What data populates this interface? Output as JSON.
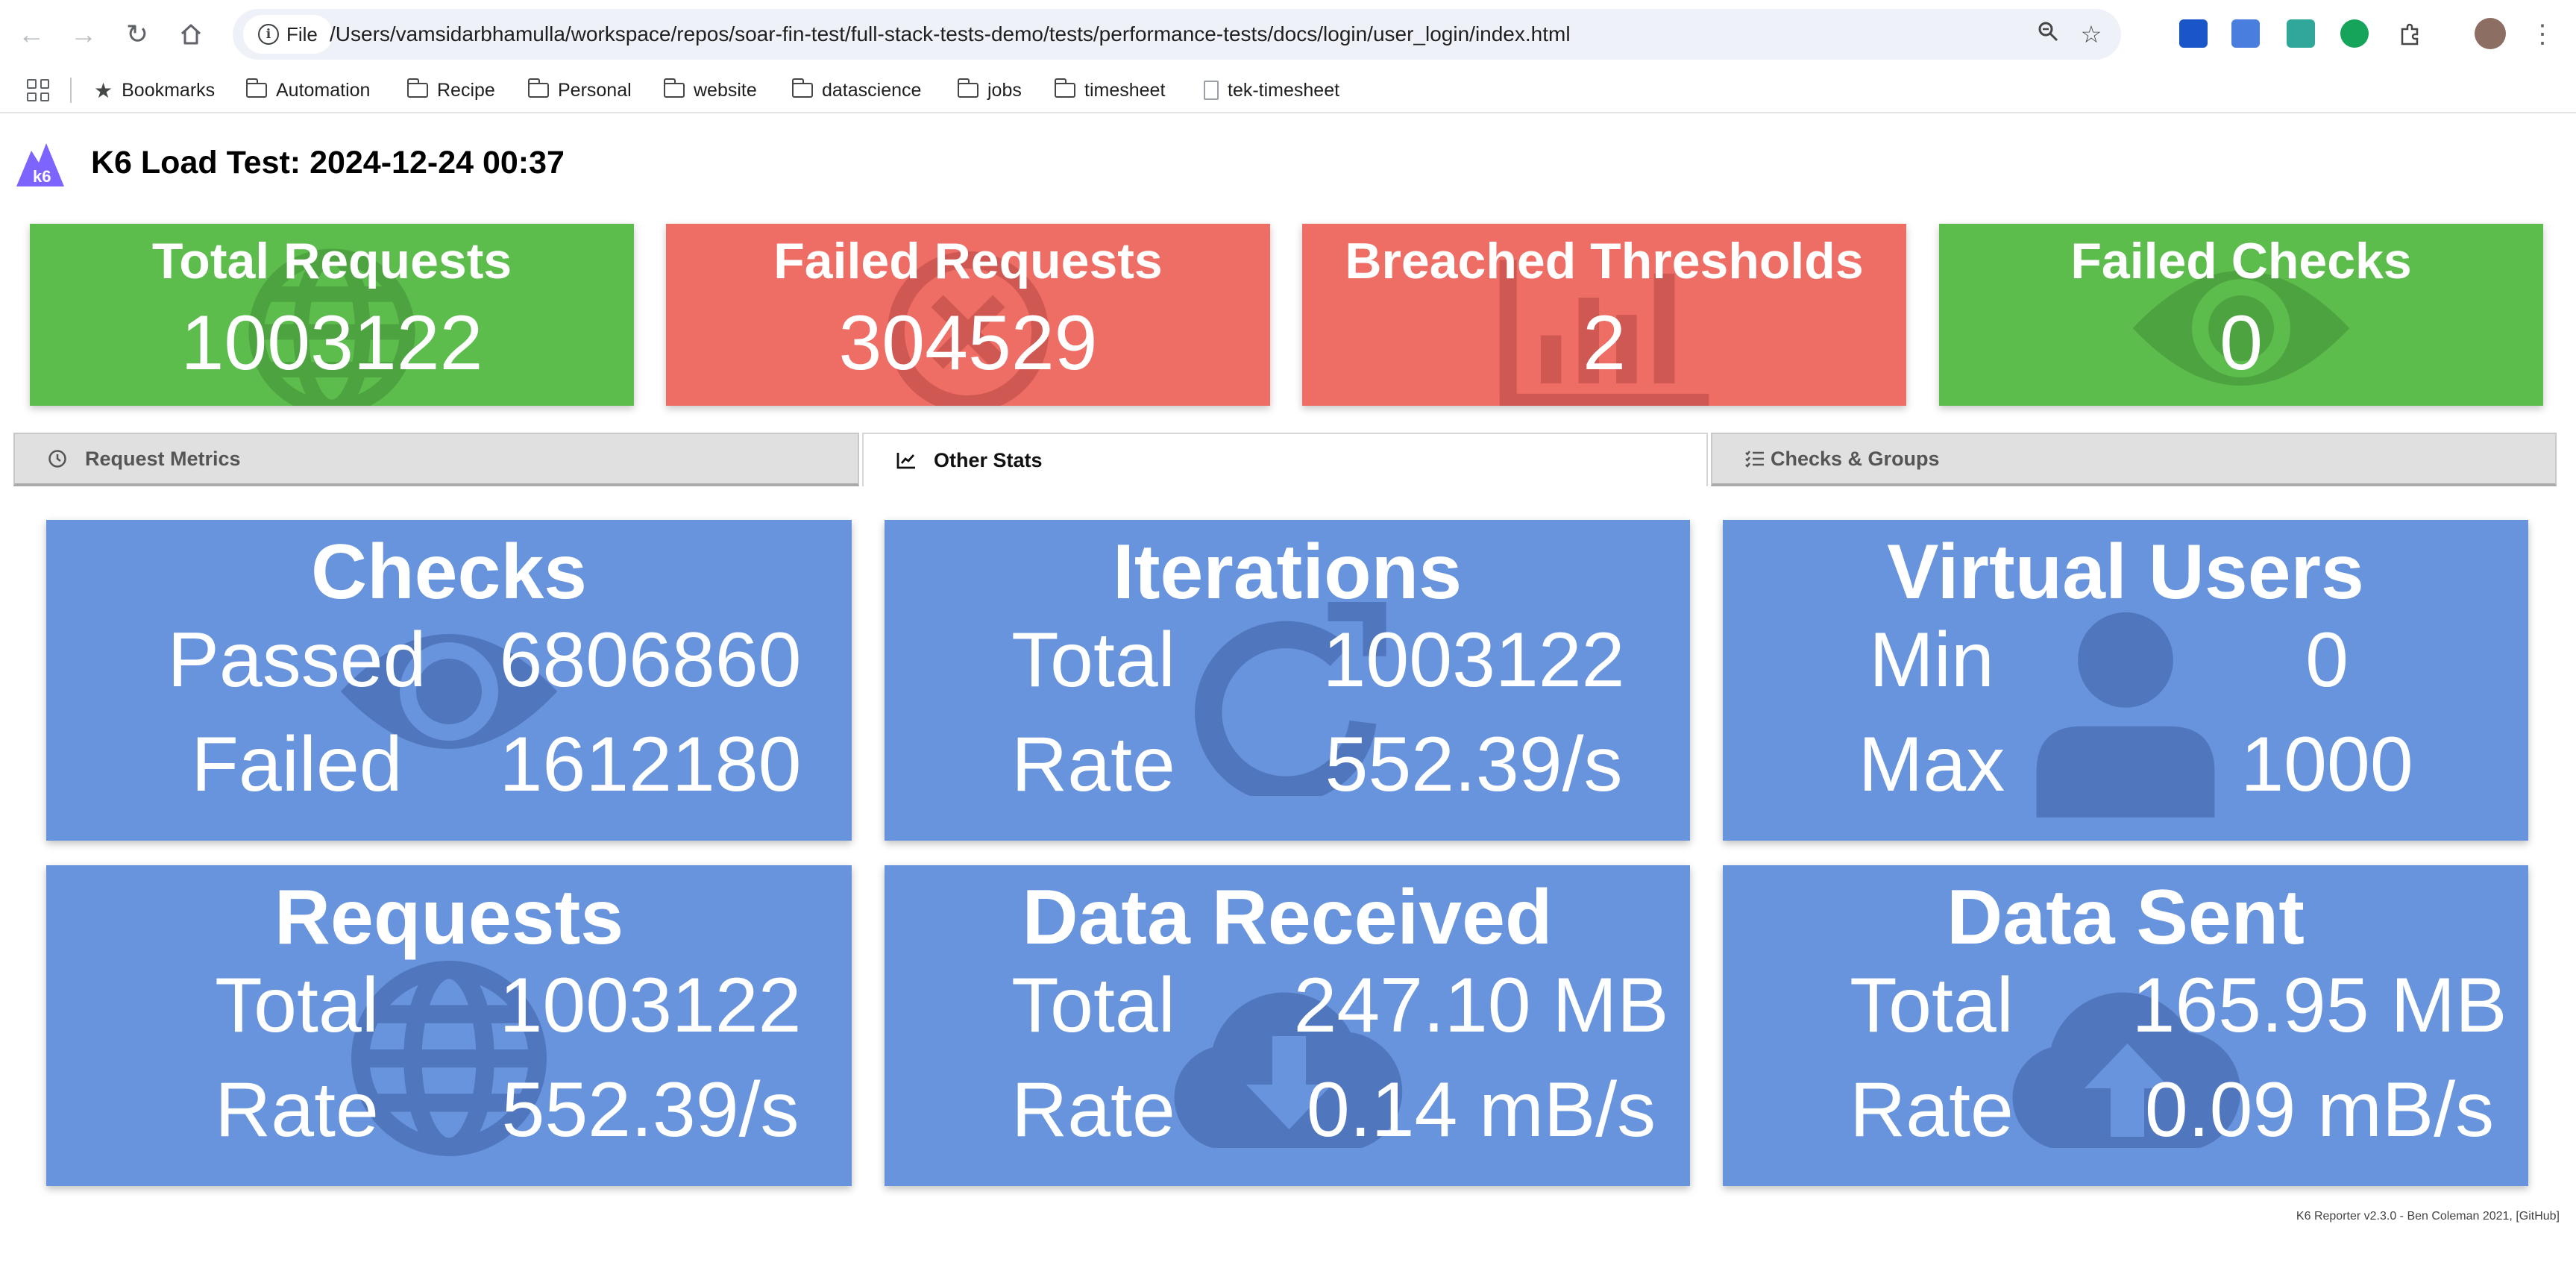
{
  "browser": {
    "file_label": "File",
    "url": "/Users/vamsidarbhamulla/workspace/repos/soar-fin-test/full-stack-tests-demo/tests/performance-tests/docs/login/user_login/index.html",
    "nav_icons": [
      "back-arrow-icon",
      "forward-arrow-icon",
      "reload-icon",
      "home-icon"
    ],
    "bookmarks": [
      {
        "label": "Bookmarks",
        "icon": "star-icon"
      },
      {
        "label": "Automation",
        "icon": "folder-icon"
      },
      {
        "label": "Recipe",
        "icon": "folder-icon"
      },
      {
        "label": "Personal",
        "icon": "folder-icon"
      },
      {
        "label": "website",
        "icon": "folder-icon"
      },
      {
        "label": "datascience",
        "icon": "folder-icon"
      },
      {
        "label": "jobs",
        "icon": "folder-icon"
      },
      {
        "label": "timesheet",
        "icon": "folder-icon"
      },
      {
        "label": "tek-timesheet",
        "icon": "page-icon"
      }
    ]
  },
  "header": {
    "logo_text": "k6",
    "title": "K6 Load Test: 2024-12-24 00:37"
  },
  "summary": [
    {
      "label": "Total Requests",
      "value": "1003122",
      "color": "#5cbd4d",
      "icon": "globe-icon"
    },
    {
      "label": "Failed Requests",
      "value": "304529",
      "color": "#ee6e66",
      "icon": "x-circle-icon"
    },
    {
      "label": "Breached Thresholds",
      "value": "2",
      "color": "#ee6e66",
      "icon": "bar-chart-icon"
    },
    {
      "label": "Failed Checks",
      "value": "0",
      "color": "#5cbd4d",
      "icon": "eye-icon"
    }
  ],
  "tabs": [
    {
      "label": "Request Metrics",
      "icon": "clock-icon",
      "active": false
    },
    {
      "label": "Other Stats",
      "icon": "line-chart-icon",
      "active": true
    },
    {
      "label": "Checks & Groups",
      "icon": "list-check-icon",
      "active": false
    }
  ],
  "cards": [
    {
      "title": "Checks",
      "icon": "eye-icon",
      "rows": [
        {
          "label": "Passed",
          "value": "6806860"
        },
        {
          "label": "Failed",
          "value": "1612180"
        }
      ]
    },
    {
      "title": "Iterations",
      "icon": "redo-icon",
      "rows": [
        {
          "label": "Total",
          "value": "1003122"
        },
        {
          "label": "Rate",
          "value": "552.39/s"
        }
      ]
    },
    {
      "title": "Virtual Users",
      "icon": "user-icon",
      "rows": [
        {
          "label": "Min",
          "value": "0"
        },
        {
          "label": "Max",
          "value": "1000"
        }
      ]
    },
    {
      "title": "Requests",
      "icon": "globe-icon",
      "rows": [
        {
          "label": "Total",
          "value": "1003122"
        },
        {
          "label": "Rate",
          "value": "552.39/s"
        }
      ]
    },
    {
      "title": "Data Received",
      "icon": "cloud-download-icon",
      "rows": [
        {
          "label": "Total",
          "value": "247.10 MB"
        },
        {
          "label": "Rate",
          "value": "0.14 mB/s"
        }
      ]
    },
    {
      "title": "Data Sent",
      "icon": "cloud-upload-icon",
      "rows": [
        {
          "label": "Total",
          "value": "165.95 MB"
        },
        {
          "label": "Rate",
          "value": "0.09 mB/s"
        }
      ]
    }
  ],
  "footer": "K6 Reporter v2.3.0 - Ben Coleman 2021, [GitHub]"
}
